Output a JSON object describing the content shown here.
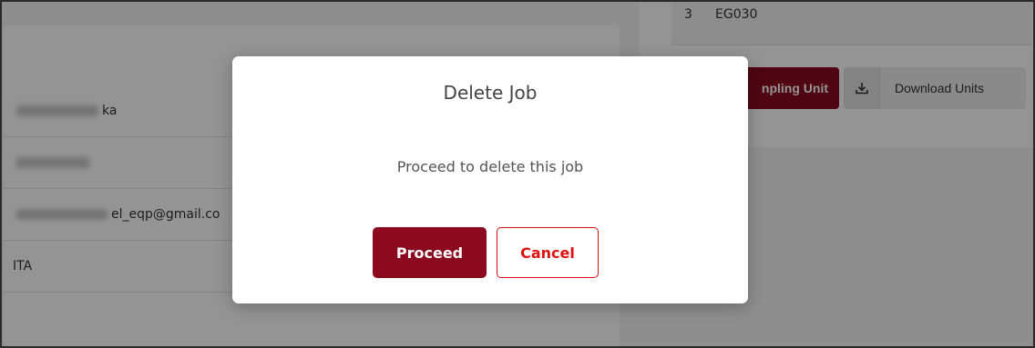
{
  "background": {
    "table": {
      "row_number": "3",
      "row_code": "EG030"
    },
    "sampling_button_label": "npling Unit",
    "download_button": {
      "icon": "download-icon",
      "label": "Download Units"
    },
    "fields": [
      {
        "visible_text": "ka"
      },
      {
        "visible_text": ""
      },
      {
        "visible_text": "el_eqp@gmail.co"
      },
      {
        "visible_text": "ITA"
      }
    ]
  },
  "modal": {
    "title": "Delete Job",
    "message": "Proceed to delete this job",
    "proceed_label": "Proceed",
    "cancel_label": "Cancel"
  },
  "colors": {
    "primary": "#8b0a1f",
    "cancel": "#e01010",
    "overlay": "rgba(0,0,0,0.42)"
  }
}
